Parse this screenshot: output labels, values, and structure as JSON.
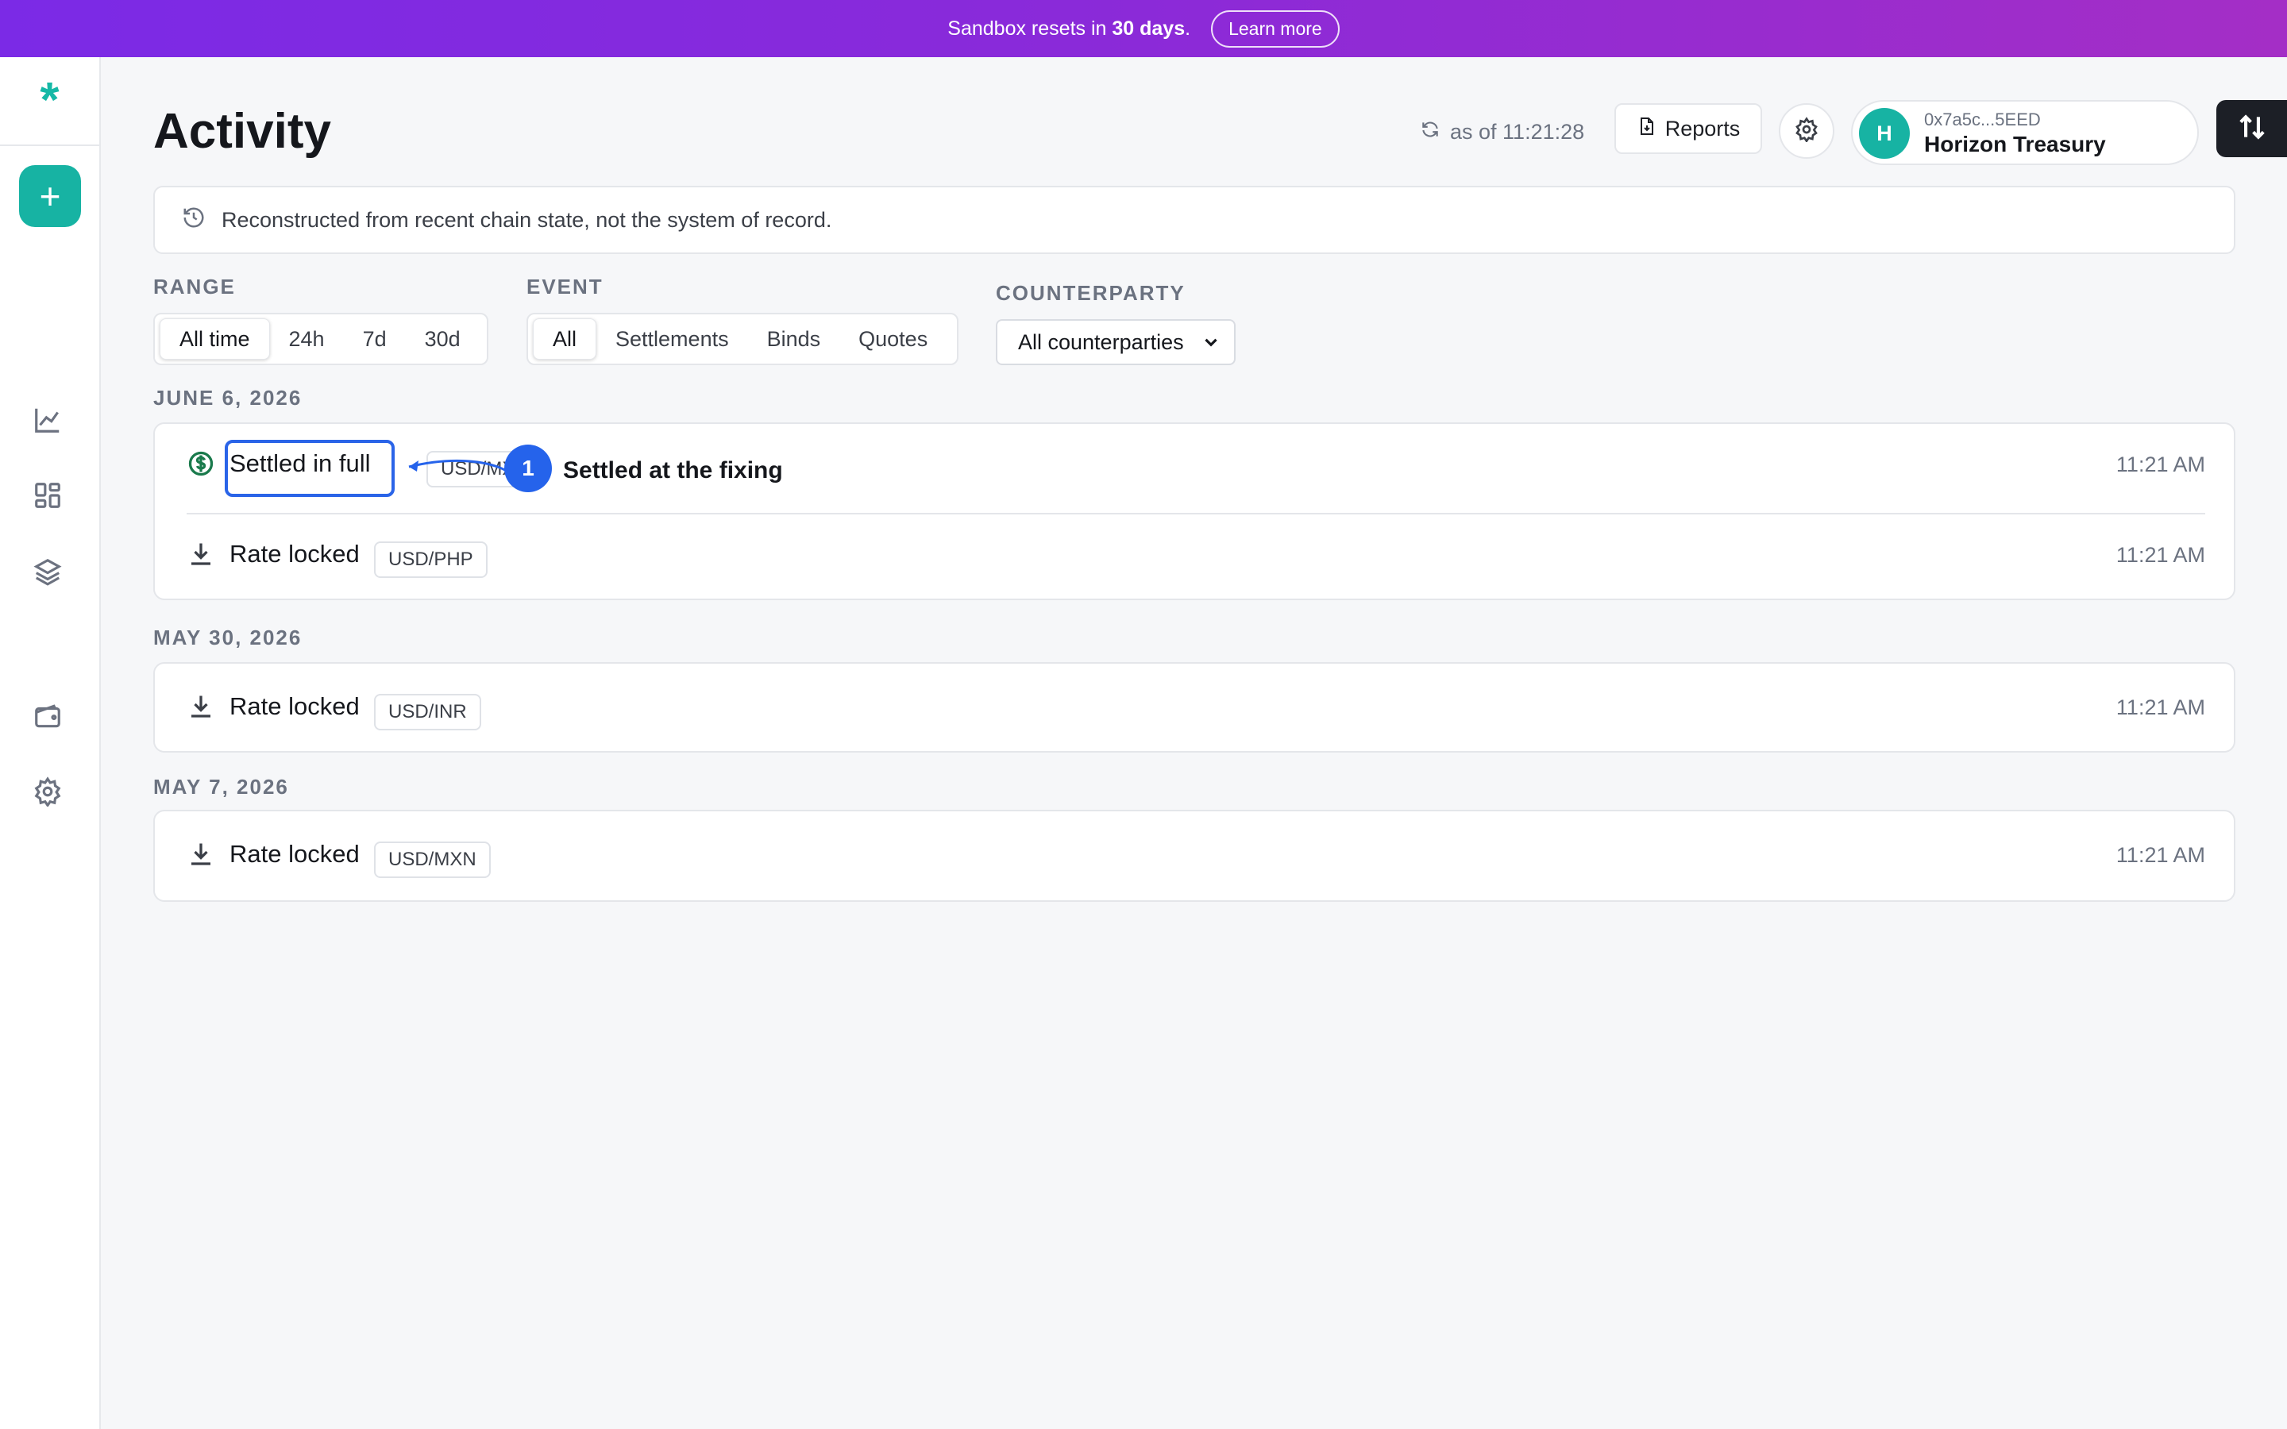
{
  "banner": {
    "text_prefix": "Sandbox resets in ",
    "text_bold": "30 days",
    "text_suffix": ".",
    "learn_more": "Learn more"
  },
  "sidebar": {
    "logo": "*",
    "add_label": "+",
    "icons": [
      "chart-icon",
      "dashboard-icon",
      "layers-icon",
      "wallet-icon",
      "settings-icon"
    ]
  },
  "header": {
    "title": "Activity",
    "as_of": "as of 11:21:28",
    "reports": "Reports",
    "account_address": "0x7a5c...5EED",
    "account_name": "Horizon Treasury",
    "avatar_initial": "H"
  },
  "notice": "Reconstructed from recent chain state, not the system of record.",
  "filters": {
    "range_label": "RANGE",
    "range_options": [
      "All time",
      "24h",
      "7d",
      "30d"
    ],
    "range_selected": "All time",
    "event_label": "EVENT",
    "event_options": [
      "All",
      "Settlements",
      "Binds",
      "Quotes"
    ],
    "event_selected": "All",
    "counterparty_label": "COUNTERPARTY",
    "counterparty_value": "All counterparties"
  },
  "groups": [
    {
      "date": "JUNE 6, 2026",
      "rows": [
        {
          "icon": "dollar-circle-icon",
          "label": "Settled in full",
          "pair": "USD/MXN",
          "time": "11:21 AM"
        },
        {
          "icon": "download-icon",
          "label": "Rate locked",
          "pair": "USD/PHP",
          "time": "11:21 AM"
        }
      ]
    },
    {
      "date": "MAY 30, 2026",
      "rows": [
        {
          "icon": "download-icon",
          "label": "Rate locked",
          "pair": "USD/INR",
          "time": "11:21 AM"
        }
      ]
    },
    {
      "date": "MAY 7, 2026",
      "rows": [
        {
          "icon": "download-icon",
          "label": "Rate locked",
          "pair": "USD/MXN",
          "time": "11:21 AM"
        }
      ]
    }
  ],
  "annotation": {
    "number": "1",
    "text": "Settled at the fixing"
  },
  "colors": {
    "accent": "#17b3a3",
    "annotation": "#2563eb",
    "banner_start": "#7b2ae6",
    "banner_end": "#a42ec6",
    "settled_icon": "#1a7a4c"
  }
}
